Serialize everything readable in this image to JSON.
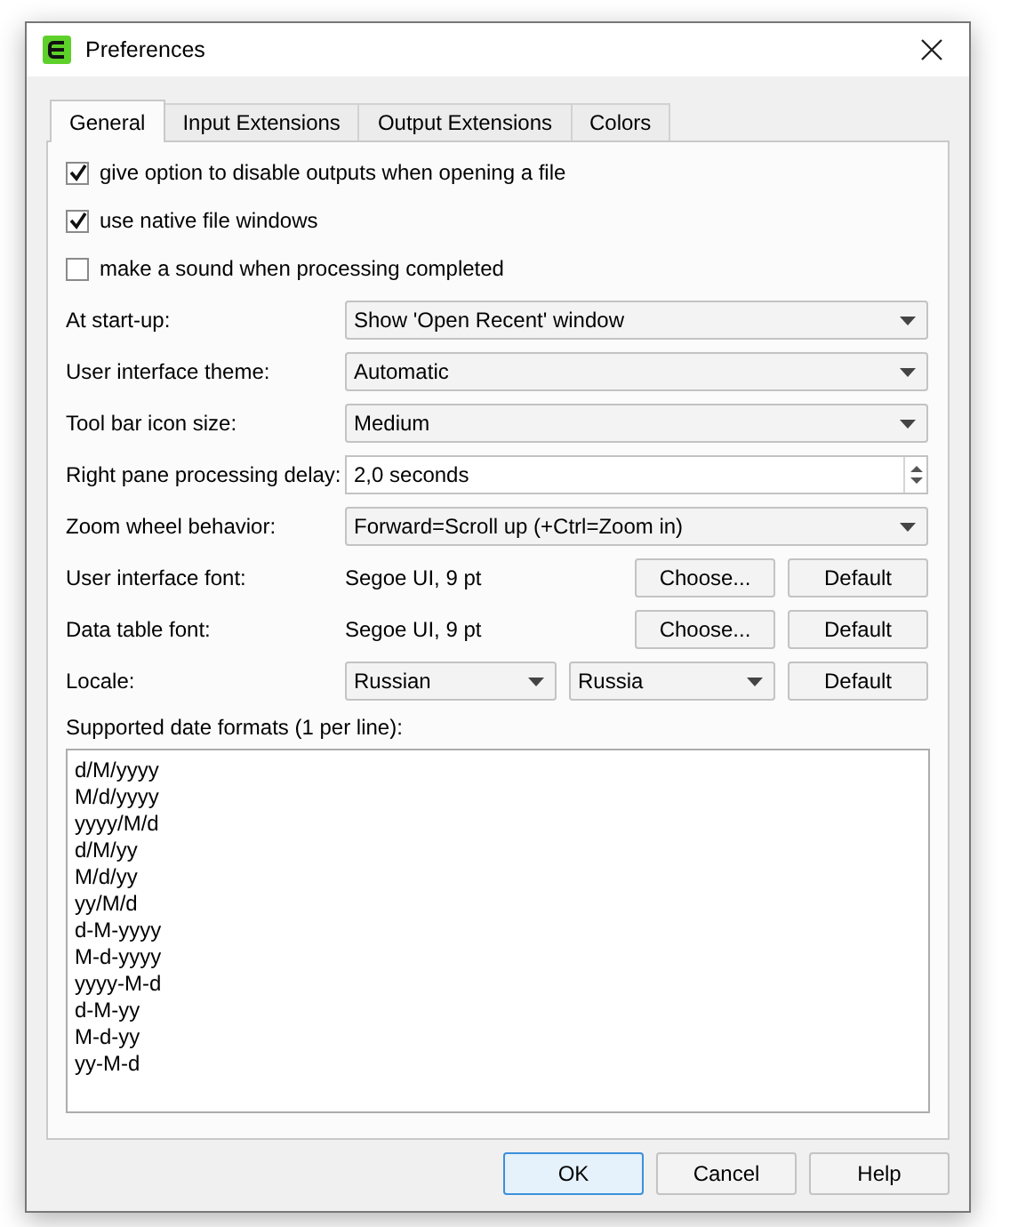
{
  "window": {
    "title": "Preferences"
  },
  "tabs": [
    {
      "label": "General",
      "selected": true
    },
    {
      "label": "Input Extensions",
      "selected": false
    },
    {
      "label": "Output Extensions",
      "selected": false
    },
    {
      "label": "Colors",
      "selected": false
    }
  ],
  "checkboxes": [
    {
      "label": "give option to disable outputs when opening a file",
      "checked": true
    },
    {
      "label": "use native file windows",
      "checked": true
    },
    {
      "label": "make a sound when processing completed",
      "checked": false
    }
  ],
  "settings": [
    {
      "kind": "dropdown",
      "label": "At start-up:",
      "value": "Show 'Open Recent' window"
    },
    {
      "kind": "dropdown",
      "label": "User interface theme:",
      "value": "Automatic"
    },
    {
      "kind": "dropdown",
      "label": "Tool bar icon size:",
      "value": "Medium"
    },
    {
      "kind": "spinner",
      "label": "Right pane processing delay:",
      "value": "2,0 seconds"
    },
    {
      "kind": "dropdown",
      "label": "Zoom wheel behavior:",
      "value": "Forward=Scroll up (+Ctrl=Zoom in)"
    },
    {
      "kind": "font",
      "label": "User interface font:",
      "value": "Segoe UI, 9 pt",
      "buttons": [
        "Choose...",
        "Default"
      ]
    },
    {
      "kind": "font",
      "label": "Data table font:",
      "value": "Segoe UI, 9 pt",
      "buttons": [
        "Choose...",
        "Default"
      ]
    },
    {
      "kind": "locale",
      "label": "Locale:",
      "language": "Russian",
      "country": "Russia",
      "buttons": [
        "Default"
      ]
    }
  ],
  "date_formats": {
    "label": "Supported date formats (1 per line):",
    "lines": [
      "d/M/yyyy",
      "M/d/yyyy",
      "yyyy/M/d",
      "d/M/yy",
      "M/d/yy",
      "yy/M/d",
      "d-M-yyyy",
      "M-d-yyyy",
      "yyyy-M-d",
      "d-M-yy",
      "M-d-yy",
      "yy-M-d"
    ]
  },
  "buttons": [
    {
      "label": "OK",
      "default": true
    },
    {
      "label": "Cancel",
      "default": false
    },
    {
      "label": "Help",
      "default": false
    }
  ]
}
